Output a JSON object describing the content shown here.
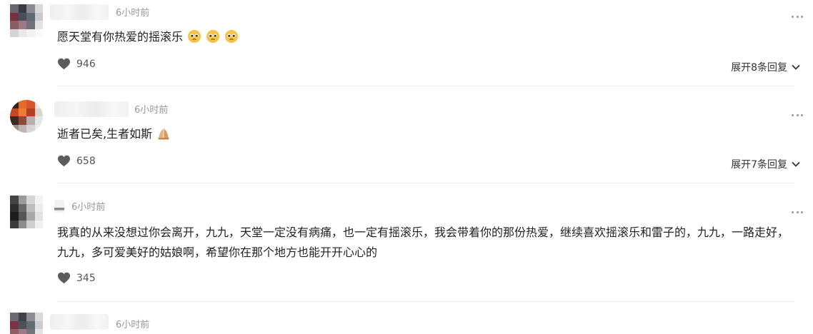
{
  "comments": [
    {
      "time": "6小时前",
      "text": "愿天堂有你热爱的摇滚乐",
      "emojis": [
        "pleading-face",
        "pleading-face",
        "pleading-face"
      ],
      "likes": "946",
      "replies": "展开8条回复"
    },
    {
      "time": "6小时前",
      "text": "逝者已矣,生者如斯",
      "emojis": [
        "folded-hands"
      ],
      "likes": "658",
      "replies": "展开7条回复"
    },
    {
      "time": "6小时前",
      "text": "我真的从来没想过你会离开，九九，天堂一定没有病痛，也一定有摇滚乐，我会带着你的那份热爱，继续喜欢摇滚乐和雷子的，九九，一路走好，九九，多可爱美好的姑娘啊，希望你在那个地方也能开开心心的",
      "likes": "345"
    },
    {
      "time": "6小时前"
    }
  ],
  "colors": {
    "text": "#222222",
    "muted": "#999999",
    "divider": "#ececec"
  }
}
